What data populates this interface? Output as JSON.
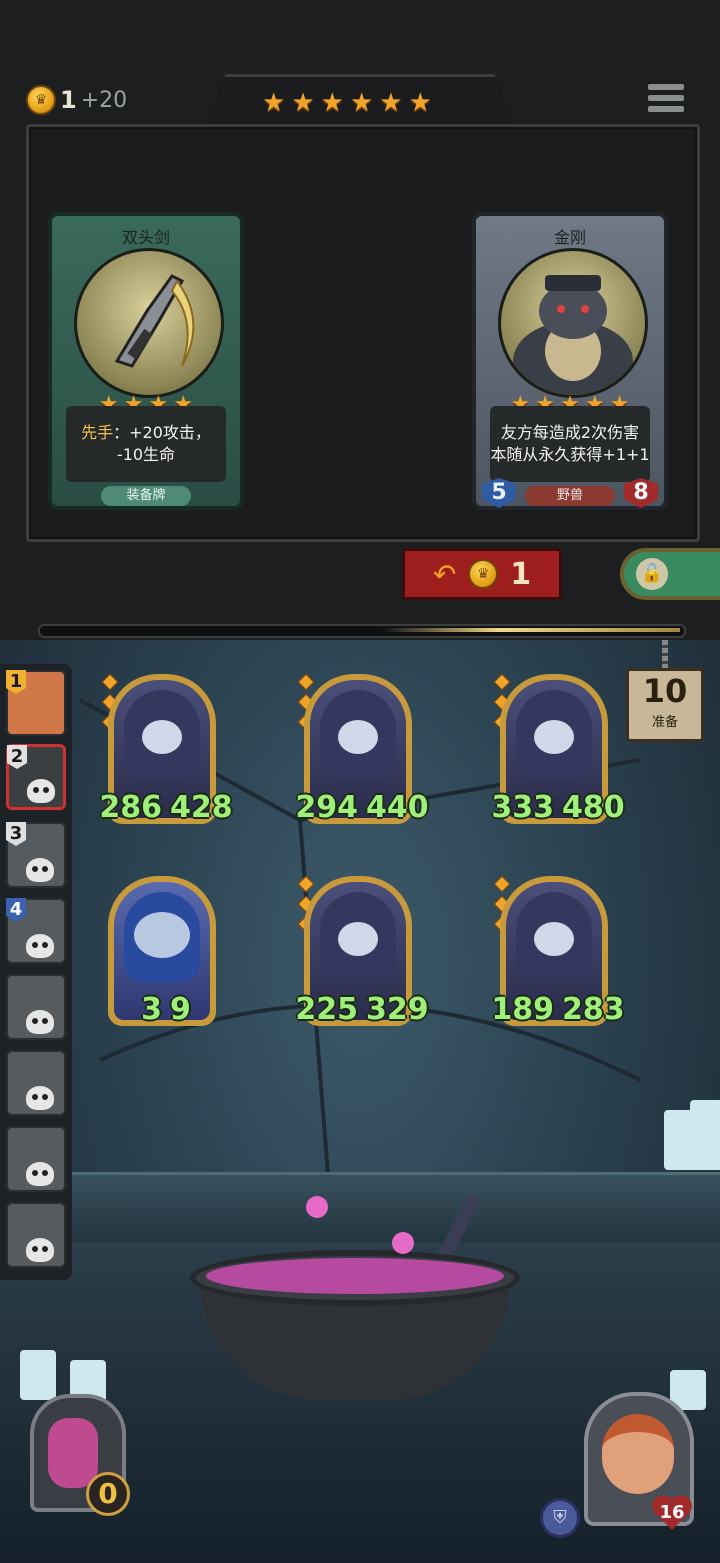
{
  "header": {
    "gold": "1",
    "gold_income": "+20",
    "tavern_stars": [
      "★",
      "★",
      "★",
      "★",
      "★",
      "★"
    ]
  },
  "shop": {
    "cards": [
      {
        "name": "双头剑",
        "stars": [
          "★",
          "★",
          "★",
          "★"
        ],
        "desc_prefix": "先手",
        "desc_line1": "：+20攻击，",
        "desc_line2": "-10生命",
        "tag": "装备牌",
        "icon": "double-headed-sword-icon"
      },
      {
        "name": "金刚",
        "stars": [
          "★",
          "★",
          "★",
          "★",
          "★"
        ],
        "desc_line1": "友方每造成2次伤害",
        "desc_line2": "本随从永久获得+1+1",
        "tag": "野兽",
        "attack": "5",
        "health": "8",
        "icon": "gorilla-icon"
      }
    ],
    "refresh_cost": "1",
    "xp_progress": 0.5
  },
  "opponents": [
    {
      "rank": "1",
      "state": "active"
    },
    {
      "rank": "2",
      "state": "current"
    },
    {
      "rank": "3",
      "state": "dead"
    },
    {
      "rank": "4",
      "state": "dead"
    },
    {
      "rank": "",
      "state": "dead"
    },
    {
      "rank": "",
      "state": "dead"
    },
    {
      "rank": "",
      "state": "dead"
    },
    {
      "rank": "",
      "state": "dead"
    }
  ],
  "prep": {
    "turns": "10",
    "label": "准备"
  },
  "board": {
    "units": [
      {
        "attack": "286",
        "health": "428",
        "kind": "hooded-assassin"
      },
      {
        "attack": "294",
        "health": "440",
        "kind": "hooded-assassin"
      },
      {
        "attack": "333",
        "health": "480",
        "kind": "hooded-assassin"
      },
      {
        "attack": "3",
        "health": "9",
        "kind": "imp"
      },
      {
        "attack": "225",
        "health": "329",
        "kind": "hooded-assassin"
      },
      {
        "attack": "189",
        "health": "283",
        "kind": "hooded-assassin"
      }
    ]
  },
  "player": {
    "coins": "0",
    "health": "16"
  },
  "colors": {
    "stat_text": "#9ef07a",
    "star": "#f0a42a",
    "refresh_button": "#9e1d1d"
  }
}
